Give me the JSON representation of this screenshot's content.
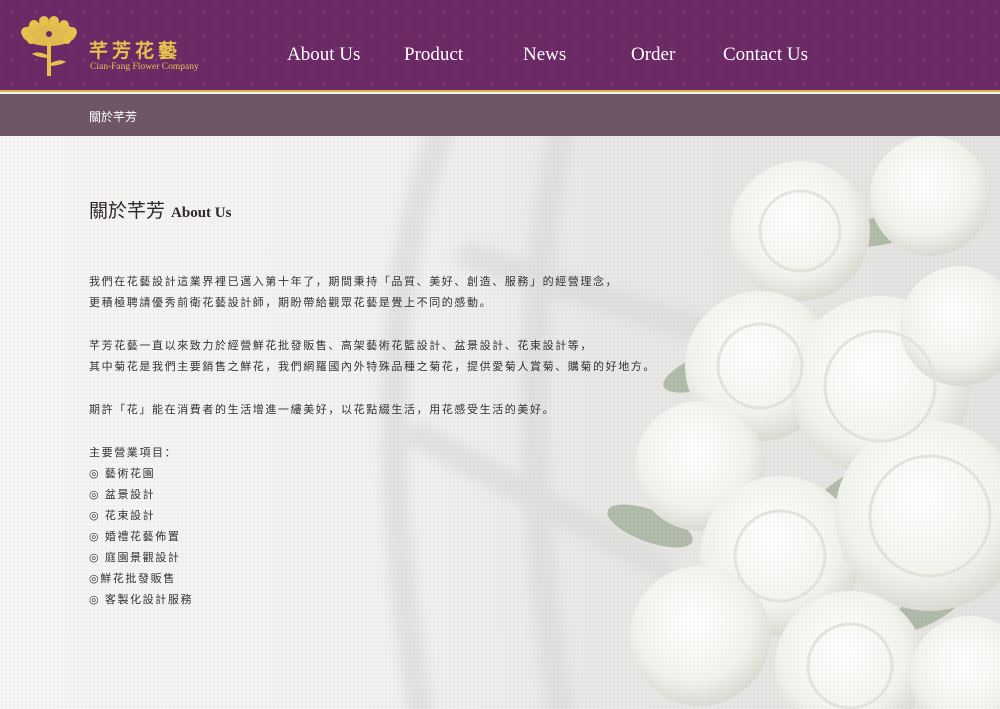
{
  "brand": {
    "name_cn": "芊芳花藝",
    "name_en": "Cian-Fang Flower Company",
    "accent": "#e5c24e",
    "header_bg": "#6b2a66"
  },
  "nav": [
    {
      "label": "About Us"
    },
    {
      "label": "Product"
    },
    {
      "label": "News"
    },
    {
      "label": "Order"
    },
    {
      "label": "Contact Us"
    }
  ],
  "breadcrumb": "關於芊芳",
  "page": {
    "title_cn": "關於芊芳",
    "title_en": "About Us",
    "paragraphs": [
      [
        "我們在花藝設計這業界裡已邁入第十年了，期間秉持「品質、美好、創造、服務」的經營理念，",
        "更積極聘請優秀前衛花藝設計師，期盼帶給觀眾花藝是覺上不同的感動。"
      ],
      [
        "芊芳花藝一直以來致力於經營鮮花批發販售、高架藝術花籃設計、盆景設計、花束設計等，",
        "其中菊花是我們主要銷售之鮮花，我們網羅國內外特殊品種之菊花，提供愛菊人賞菊、購菊的好地方。"
      ],
      [
        "期許「花」能在消費者的生活增進一縷美好，以花點綴生活，用花感受生活的美好。"
      ]
    ],
    "services_title": "主要營業項目：",
    "services": [
      "◎ 藝術花園",
      "◎ 盆景設計",
      "◎ 花束設計",
      "◎ 婚禮花藝佈置",
      "◎ 庭園景觀設計",
      "◎鮮花批發販售",
      "◎ 客製化設計服務"
    ]
  }
}
